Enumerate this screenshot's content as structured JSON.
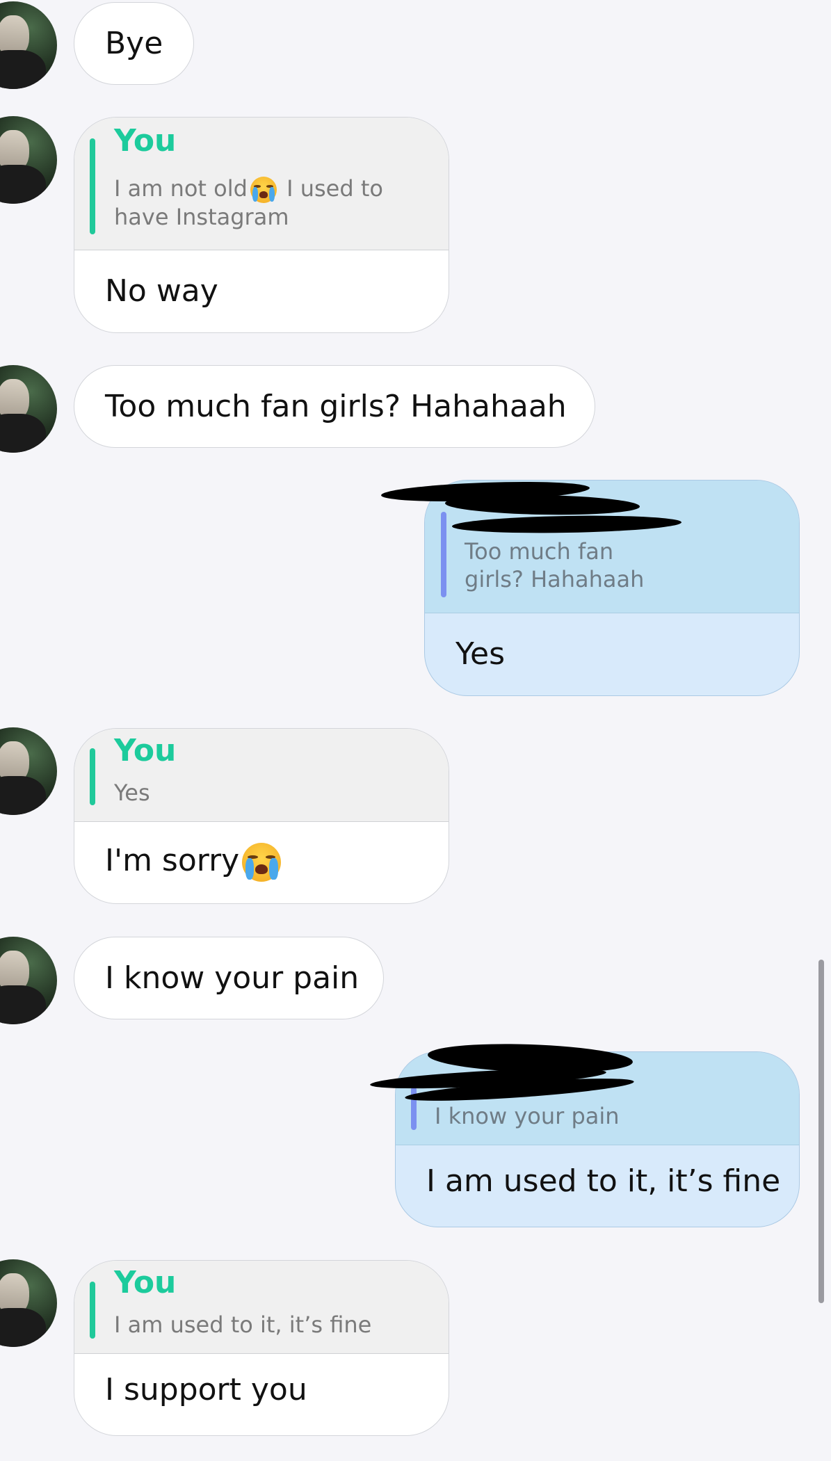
{
  "messages": [
    {
      "type": "text",
      "from": "them",
      "text": "Bye"
    },
    {
      "type": "reply",
      "from": "them",
      "quoted_name": "You",
      "quoted_text_a": "I am not old",
      "quoted_text_b": " I used to\nhave Instagram",
      "text": "No way"
    },
    {
      "type": "text",
      "from": "them",
      "text": "Too much fan girls? Hahahaah"
    },
    {
      "type": "reply",
      "from": "me",
      "quoted_text": "Too much fan\ngirls? Hahahaah",
      "text": "Yes"
    },
    {
      "type": "reply",
      "from": "them",
      "quoted_name": "You",
      "quoted_text": "Yes",
      "text": "I'm sorry"
    },
    {
      "type": "text",
      "from": "them",
      "text": "I know your pain"
    },
    {
      "type": "reply",
      "from": "me",
      "quoted_text": "I know your pain",
      "text": "I am used to it, it’s fine"
    },
    {
      "type": "reply",
      "from": "them",
      "quoted_name": "You",
      "quoted_text": "I am used to it, it’s fine",
      "text": "I support you"
    }
  ],
  "icons": {
    "avatar": "profile-photo",
    "crying_emoji": "loudly-crying-face"
  },
  "colors": {
    "background": "#f5f5f9",
    "their_bubble": "#ffffff",
    "their_quote": "#f0f0f0",
    "my_bubble": "#d8eafb",
    "my_quote": "#bfe1f3",
    "reply_name": "#1ccb9c",
    "their_quote_bar": "#20c99a",
    "my_quote_bar": "#7b90f0",
    "redaction": "#000000"
  }
}
